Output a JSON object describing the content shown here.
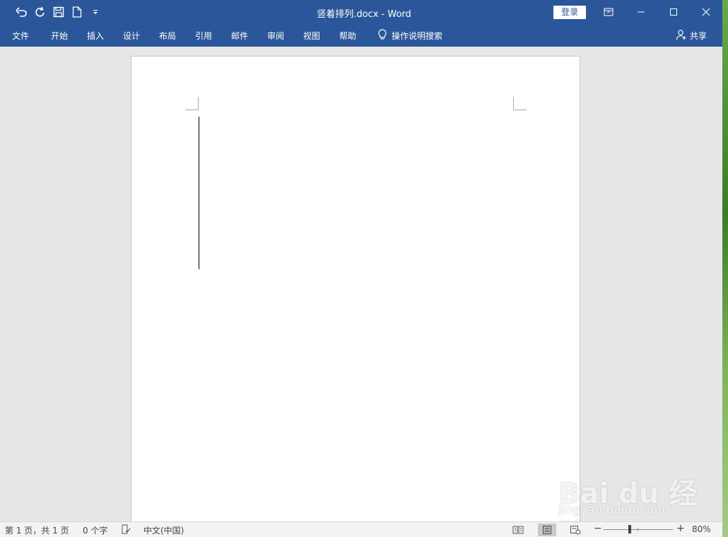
{
  "titlebar": {
    "document_title": "竖着排列.docx  -  Word",
    "sign_in_label": "登录",
    "qat_icons": [
      "undo-icon",
      "redo-icon",
      "save-icon",
      "new-document-icon",
      "customize-qat-icon"
    ],
    "window_icons": [
      "ribbon-display-options-icon",
      "minimize-icon",
      "maximize-icon",
      "close-icon"
    ]
  },
  "ribbon": {
    "tabs": [
      "文件",
      "开始",
      "插入",
      "设计",
      "布局",
      "引用",
      "邮件",
      "审阅",
      "视图",
      "帮助"
    ],
    "tell_me": "操作说明搜索",
    "share": "共享"
  },
  "statusbar": {
    "page_info": "第 1 页，共 1 页",
    "word_count": "0 个字",
    "language": "中文(中国)",
    "zoom_level": "80%",
    "zoom_minus": "−",
    "zoom_plus": "+"
  },
  "watermark": {
    "logo": "Bai du 经验",
    "url": "jingyan.baidu.com"
  },
  "colors": {
    "ribbon": "#2b579a",
    "workspace": "#e6e6e6",
    "page": "#ffffff"
  }
}
